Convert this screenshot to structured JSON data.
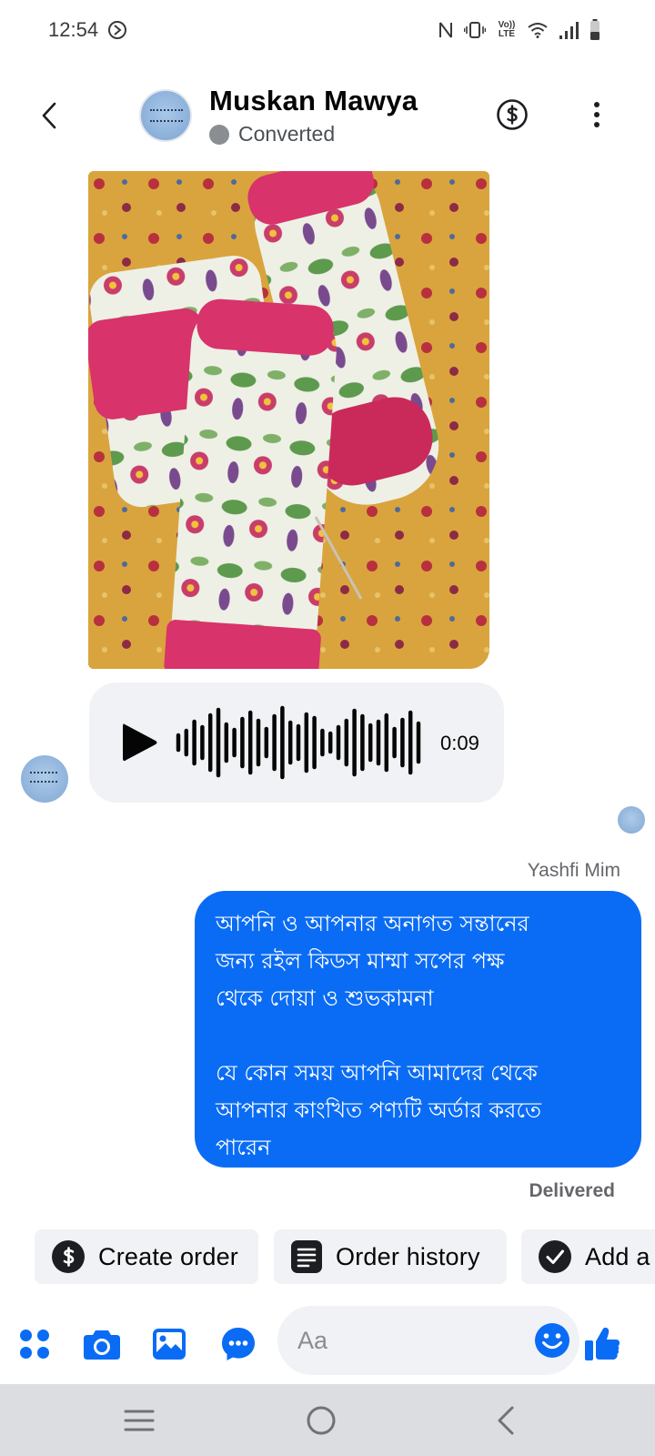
{
  "status_bar": {
    "time": "12:54",
    "volte_label": "Vo)) LTE"
  },
  "header": {
    "contact_name": "Muskan Mawya",
    "contact_status": "Converted"
  },
  "voice_message": {
    "duration": "0:09"
  },
  "outgoing": {
    "sender_name": "Yashfi Mim",
    "message": "আপনি ও আপনার অনাগত সন্তানের\nজন্য রইল কিডস মাম্মা সপের পক্ষ\nথেকে দোয়া ও শুভকামনা\n\nযে কোন সময় আপনি আমাদের থেকে\nআপনার কাংখিত পণ্যটি অর্ডার করতে\nপারেন",
    "delivery_status": "Delivered"
  },
  "quick_actions": [
    {
      "label": "Create order",
      "icon": "dollar-circle-icon"
    },
    {
      "label": "Order history",
      "icon": "document-list-icon"
    },
    {
      "label": "Add a",
      "icon": "check-circle-icon"
    }
  ],
  "composer": {
    "placeholder": "Aa",
    "icons": [
      "apps-grid-icon",
      "camera-icon",
      "gallery-icon",
      "chat-more-icon",
      "emoji-icon",
      "like-icon"
    ]
  },
  "colors": {
    "accent": "#0a6cf5",
    "bubble_gray": "#f0f2f5",
    "status_dot": "#8a8d91",
    "navbar": "#dcdde0"
  }
}
